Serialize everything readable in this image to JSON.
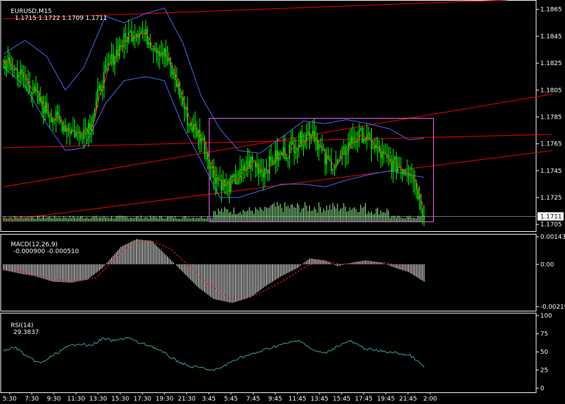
{
  "header": {
    "symbol": "EURUSD,M15",
    "ohlc": "1.1715 1.1722 1.1709 1.1711",
    "macd_label": "MACD(12,26,9)",
    "macd_values": "-0.000900 -0.000510",
    "rsi_label": "RSI(14)",
    "rsi_value": "29.3837"
  },
  "colors": {
    "background": "#000000",
    "candle": "#00ff00",
    "price_ma": "#ff2020",
    "bollinger": "#4a6cff",
    "trendline": "#ff0000",
    "box": "#ff66ff",
    "volume": "#9cff9c",
    "macd_hist": "#ffffff",
    "macd_signal": "#ff2020",
    "rsi": "#3aa8a8",
    "axis_text": "#ffffff"
  },
  "chart_data": [
    {
      "type": "candlestick",
      "panel": "price",
      "ylim": [
        1.17,
        1.1872
      ],
      "y_ticks": [
        "1.1865",
        "1.1845",
        "1.1825",
        "1.1805",
        "1.1785",
        "1.1765",
        "1.1745",
        "1.1725",
        "1.1705"
      ],
      "last_price": "1.1711",
      "close_anchors": [
        [
          0,
          1.1826
        ],
        [
          8,
          1.182
        ],
        [
          16,
          1.181
        ],
        [
          24,
          1.1795
        ],
        [
          32,
          1.1785
        ],
        [
          40,
          1.1778
        ],
        [
          48,
          1.1772
        ],
        [
          56,
          1.178
        ],
        [
          64,
          1.1812
        ],
        [
          72,
          1.1832
        ],
        [
          80,
          1.1845
        ],
        [
          88,
          1.185
        ],
        [
          96,
          1.184
        ],
        [
          104,
          1.1832
        ],
        [
          112,
          1.181
        ],
        [
          120,
          1.178
        ],
        [
          128,
          1.177
        ],
        [
          136,
          1.1742
        ],
        [
          144,
          1.1733
        ],
        [
          152,
          1.174
        ],
        [
          160,
          1.1752
        ],
        [
          168,
          1.1745
        ],
        [
          176,
          1.1755
        ],
        [
          184,
          1.176
        ],
        [
          192,
          1.1768
        ],
        [
          200,
          1.1775
        ],
        [
          208,
          1.1752
        ],
        [
          216,
          1.175
        ],
        [
          224,
          1.1766
        ],
        [
          232,
          1.1772
        ],
        [
          240,
          1.1762
        ],
        [
          248,
          1.1752
        ],
        [
          256,
          1.1748
        ],
        [
          264,
          1.1745
        ],
        [
          272,
          1.1712
        ]
      ],
      "bands_upper": [
        [
          0,
          1.1832
        ],
        [
          14,
          1.1842
        ],
        [
          28,
          1.183
        ],
        [
          40,
          1.1805
        ],
        [
          52,
          1.1822
        ],
        [
          66,
          1.186
        ],
        [
          78,
          1.1855
        ],
        [
          92,
          1.1862
        ],
        [
          104,
          1.1866
        ],
        [
          116,
          1.184
        ],
        [
          128,
          1.18
        ],
        [
          140,
          1.1776
        ],
        [
          152,
          1.176
        ],
        [
          166,
          1.1758
        ],
        [
          180,
          1.177
        ],
        [
          194,
          1.1782
        ],
        [
          208,
          1.178
        ],
        [
          222,
          1.1783
        ],
        [
          236,
          1.178
        ],
        [
          250,
          1.1776
        ],
        [
          262,
          1.1768
        ],
        [
          272,
          1.1769
        ]
      ],
      "bands_lower": [
        [
          0,
          1.1822
        ],
        [
          14,
          1.1808
        ],
        [
          28,
          1.178
        ],
        [
          40,
          1.176
        ],
        [
          52,
          1.1762
        ],
        [
          66,
          1.1795
        ],
        [
          78,
          1.1812
        ],
        [
          92,
          1.1815
        ],
        [
          104,
          1.1812
        ],
        [
          116,
          1.1778
        ],
        [
          128,
          1.1752
        ],
        [
          140,
          1.1725
        ],
        [
          152,
          1.1725
        ],
        [
          166,
          1.173
        ],
        [
          180,
          1.1735
        ],
        [
          194,
          1.1735
        ],
        [
          208,
          1.1733
        ],
        [
          222,
          1.1738
        ],
        [
          236,
          1.1742
        ],
        [
          250,
          1.1745
        ],
        [
          262,
          1.1742
        ],
        [
          272,
          1.174
        ]
      ],
      "trendlines": [
        {
          "from": [
            0,
            1.1858
          ],
          "to": [
            326,
            1.1872
          ]
        },
        {
          "from": [
            0,
            1.1762
          ],
          "to": [
            355,
            1.1772
          ]
        },
        {
          "from": [
            0,
            1.1733
          ],
          "to": [
            355,
            1.1802
          ]
        },
        {
          "from": [
            0,
            1.1708
          ],
          "to": [
            355,
            1.176
          ]
        }
      ],
      "box": {
        "from": [
          133,
          1.1784
        ],
        "to": [
          278,
          1.1707
        ]
      }
    },
    {
      "type": "bar",
      "panel": "volume",
      "note": "tick volume bars at bottom of price panel"
    },
    {
      "type": "bar",
      "panel": "macd",
      "ylim": [
        -0.00219,
        0.00143
      ],
      "y_ticks": [
        "0.00143",
        "0.00",
        "-0.00219"
      ],
      "hist_anchors": [
        [
          0,
          -0.0003
        ],
        [
          12,
          -0.0005
        ],
        [
          20,
          -0.0006
        ],
        [
          32,
          -0.0009
        ],
        [
          44,
          -0.00095
        ],
        [
          54,
          -0.0008
        ],
        [
          64,
          -0.0002
        ],
        [
          76,
          0.0009
        ],
        [
          86,
          0.0013
        ],
        [
          96,
          0.0012
        ],
        [
          106,
          0.0004
        ],
        [
          116,
          -0.0004
        ],
        [
          126,
          -0.0012
        ],
        [
          136,
          -0.0018
        ],
        [
          148,
          -0.002
        ],
        [
          160,
          -0.0017
        ],
        [
          170,
          -0.0011
        ],
        [
          180,
          -0.0006
        ],
        [
          190,
          -0.0002
        ],
        [
          198,
          0.0003
        ],
        [
          208,
          0.0002
        ],
        [
          216,
          -0.0001
        ],
        [
          226,
          0.0001
        ],
        [
          234,
          0.0002
        ],
        [
          244,
          0.0001
        ],
        [
          254,
          -0.0002
        ],
        [
          262,
          -0.0004
        ],
        [
          272,
          -0.0009
        ]
      ],
      "signal_anchors": [
        [
          0,
          -0.0002
        ],
        [
          16,
          -0.00045
        ],
        [
          30,
          -0.00075
        ],
        [
          44,
          -0.0009
        ],
        [
          60,
          -0.0007
        ],
        [
          72,
          0.0003
        ],
        [
          82,
          0.001
        ],
        [
          94,
          0.00125
        ],
        [
          108,
          0.0008
        ],
        [
          120,
          -0.0001
        ],
        [
          132,
          -0.001
        ],
        [
          146,
          -0.00175
        ],
        [
          156,
          -0.0018
        ],
        [
          168,
          -0.0014
        ],
        [
          182,
          -0.0008
        ],
        [
          196,
          -0.0001
        ],
        [
          206,
          0.0002
        ],
        [
          218,
          0.0
        ],
        [
          232,
          0.0001
        ],
        [
          246,
          0.0001
        ],
        [
          262,
          -0.0002
        ],
        [
          272,
          -0.00051
        ]
      ]
    },
    {
      "type": "line",
      "panel": "rsi",
      "ylim": [
        0,
        100
      ],
      "y_ticks": [
        "100",
        "75",
        "50",
        "25",
        "0"
      ],
      "anchors": [
        [
          0,
          52
        ],
        [
          8,
          56
        ],
        [
          16,
          42
        ],
        [
          24,
          34
        ],
        [
          32,
          45
        ],
        [
          40,
          55
        ],
        [
          48,
          62
        ],
        [
          56,
          58
        ],
        [
          64,
          68
        ],
        [
          72,
          65
        ],
        [
          80,
          70
        ],
        [
          88,
          62
        ],
        [
          96,
          58
        ],
        [
          104,
          48
        ],
        [
          112,
          38
        ],
        [
          120,
          30
        ],
        [
          128,
          28
        ],
        [
          136,
          24
        ],
        [
          144,
          32
        ],
        [
          152,
          42
        ],
        [
          160,
          46
        ],
        [
          168,
          52
        ],
        [
          176,
          58
        ],
        [
          184,
          62
        ],
        [
          192,
          66
        ],
        [
          200,
          52
        ],
        [
          208,
          48
        ],
        [
          216,
          58
        ],
        [
          224,
          65
        ],
        [
          232,
          56
        ],
        [
          240,
          52
        ],
        [
          248,
          50
        ],
        [
          256,
          48
        ],
        [
          264,
          44
        ],
        [
          272,
          29
        ]
      ]
    }
  ],
  "x_axis": {
    "labels": [
      "5:30",
      "7:30",
      "9:30",
      "11:30",
      "13:30",
      "15:30",
      "17:30",
      "19:30",
      "21:30",
      "3:45",
      "5:45",
      "7:45",
      "9:45",
      "11:45",
      "13:45",
      "15:45",
      "17:45",
      "19:45",
      "21:45",
      "2:00"
    ],
    "label_bars": [
      0,
      16,
      32,
      48,
      64,
      80,
      96,
      112,
      128,
      144,
      160,
      176,
      192,
      208,
      224,
      240,
      256,
      272,
      288,
      304
    ]
  }
}
